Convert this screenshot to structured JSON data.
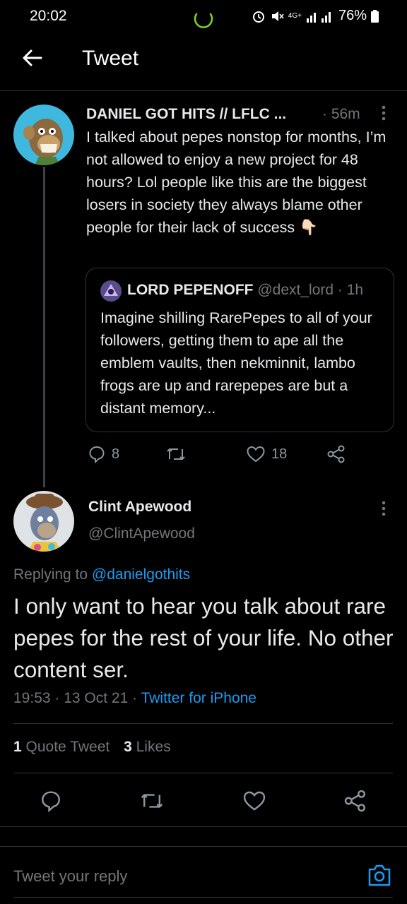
{
  "status_bar": {
    "time": "20:02",
    "network": "4G+",
    "battery": "76%"
  },
  "header": {
    "title": "Tweet"
  },
  "parent_tweet": {
    "author_name": "DANIEL GOT HITS // LFLC ...",
    "time": "· 56m",
    "text": "I talked about pepes nonstop for months, I’m not allowed to enjoy a new project for 48 hours? Lol people like this are the biggest losers in society they always blame other people for their lack of success 👇🏻",
    "quote": {
      "author_name": "LORD PEPENOFF",
      "handle": "@dext_lord",
      "time": "· 1h",
      "text": "Imagine shilling RarePepes to all of your followers, getting them to ape all the emblem vaults, then nekminnit, lambo frogs are up and rarepepes are but a distant memory..."
    },
    "actions": {
      "replies": "8",
      "retweets": "",
      "likes": "18"
    }
  },
  "main_tweet": {
    "author_name": "Clint Apewood",
    "handle": "@ClintApewood",
    "replying_prefix": "Replying to",
    "replying_to": "@danielgothits",
    "text": "I only want to hear you talk about rare pepes for the rest of your life. No other content ser.",
    "time": "19:53 · 13 Oct 21 ·",
    "source": "Twitter for iPhone",
    "stats": {
      "quote_count": "1",
      "quote_label": "Quote Tweet",
      "likes_count": "3",
      "likes_label": "Likes"
    }
  },
  "reply_bar": {
    "placeholder": "Tweet your reply"
  },
  "colors": {
    "background": "#000000",
    "text": "#e7e9ea",
    "secondary": "#71767b",
    "accent": "#1d9bf0",
    "divider": "#2f3336"
  }
}
